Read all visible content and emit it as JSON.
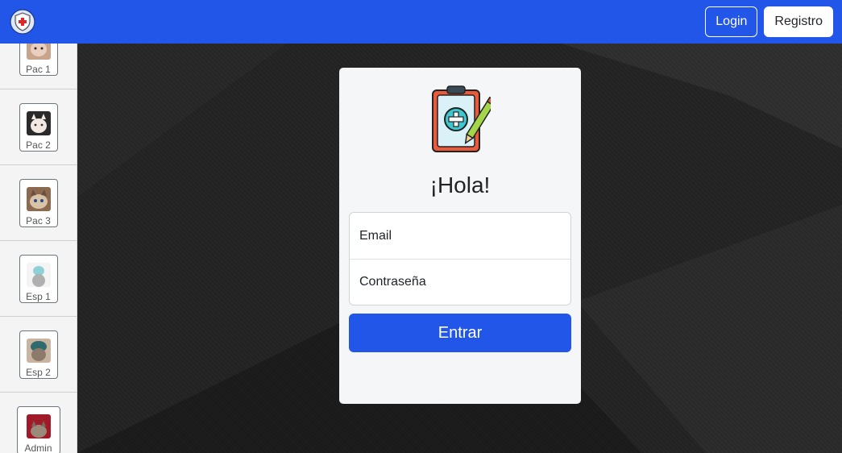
{
  "navbar": {
    "brand_icon": "shield-medical-icon",
    "login_label": "Login",
    "registro_label": "Registro",
    "accent": "#2256e8"
  },
  "sidebar": {
    "users": [
      {
        "label": "Pac 1",
        "avatar": "cat-avatar"
      },
      {
        "label": "Pac 2",
        "avatar": "cat-avatar"
      },
      {
        "label": "Pac 3",
        "avatar": "cat-avatar"
      },
      {
        "label": "Esp 1",
        "avatar": "cat-avatar"
      },
      {
        "label": "Esp 2",
        "avatar": "cat-avatar"
      },
      {
        "label": "Admin",
        "avatar": "cat-avatar"
      }
    ]
  },
  "login": {
    "logo_icon": "clipboard-medical-icon",
    "greeting": "¡Hola!",
    "email_placeholder": "Email",
    "password_placeholder": "Contraseña",
    "submit_label": "Entrar"
  }
}
